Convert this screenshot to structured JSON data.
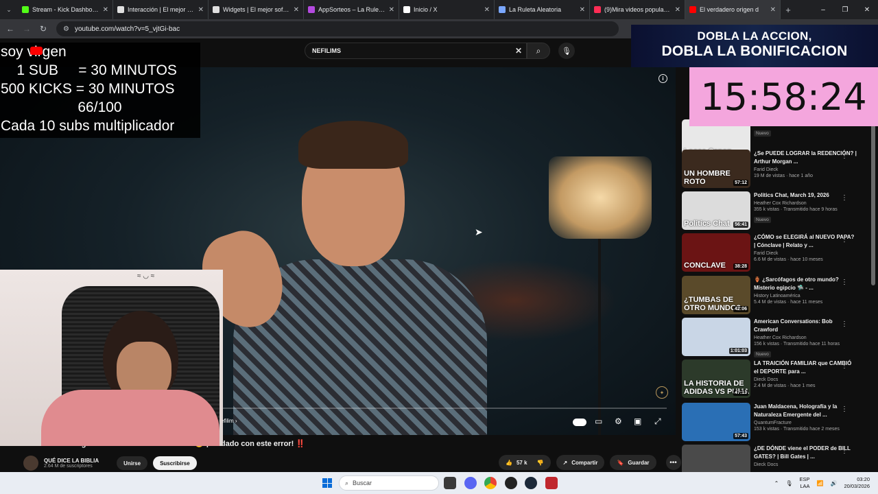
{
  "browser": {
    "menu_icon": "chevron-down-icon",
    "tabs": [
      {
        "title": "Stream - Kick Dashboard",
        "favicon_color": "#53fc18",
        "active": false
      },
      {
        "title": "Interacción | El mejor software",
        "favicon_color": "#e0e0e0",
        "active": false
      },
      {
        "title": "Widgets | El mejor software",
        "favicon_color": "#e0e0e0",
        "active": false
      },
      {
        "title": "AppSorteos – La Ruleta de",
        "favicon_color": "#b44ae0",
        "active": false
      },
      {
        "title": "Inicio / X",
        "favicon_color": "#ffffff",
        "active": false
      },
      {
        "title": "La Ruleta Aleatoria",
        "favicon_color": "#7aa7ff",
        "active": false
      },
      {
        "title": "(9)Mira videos populares",
        "favicon_color": "#ff2d55",
        "active": false
      },
      {
        "title": "El verdadero origen d",
        "favicon_color": "#ff0000",
        "active": true
      }
    ],
    "new_tab": "+",
    "window_controls": [
      "–",
      "❐",
      "✕"
    ],
    "url": "youtube.com/watch?v=5_vjtGi-bac"
  },
  "youtube": {
    "search_value": "NEFILIMS",
    "video_title": "El verdadero origen de los GIGANTES NEFILIM 😳 ¡Cuidado con este error! ‼️",
    "chapter": "efilim ›",
    "channel": {
      "name": "QUÉ DICE LA BIBLIA",
      "subscribers": "2.64 M de suscriptores"
    },
    "join_label": "Unirse",
    "subscribe_label": "Suscribirse",
    "likes": "57 k",
    "share_label": "Compartir",
    "save_label": "Guardar",
    "recommended": [
      {
        "title": "",
        "channel": "",
        "meta": "43 k vistas · hace 4 horas",
        "duration": "54:26",
        "new": "Nuevo",
        "thumb_text": "Loose Canon",
        "thumb_color": "#e8e8e8"
      },
      {
        "title": "¿Se PUEDE LOGRAR la REDENCIÓN? | Arthur Morgan ...",
        "channel": "Farid Dieck",
        "meta": "19 M de vistas · hace 1 año",
        "duration": "57:12",
        "new": "",
        "thumb_text": "UN HOMBRE ROTO",
        "thumb_color": "#3b2a1e"
      },
      {
        "title": "Politics Chat, March 19, 2026",
        "channel": "Heather Cox Richardson",
        "meta": "355 k vistas · Transmitido hace 9 horas",
        "duration": "56:41",
        "new": "Nuevo",
        "thumb_text": "Politics Chat",
        "thumb_color": "#dcdcdc"
      },
      {
        "title": "¿CÓMO se ELEGIRÁ al NUEVO PAPA? | Cónclave | Relato y ...",
        "channel": "Farid Dieck",
        "meta": "6.6 M de vistas · hace 10 meses",
        "duration": "38:28",
        "new": "",
        "thumb_text": "CONCLAVE",
        "thumb_color": "#6b1414"
      },
      {
        "title": "🏺 ¿Sarcófagos de otro mundo? Misterio egipcio 🛸 - ...",
        "channel": "History Latinoamérica",
        "meta": "5.4 M de vistas · hace 11 meses",
        "duration": "42:06",
        "new": "",
        "thumb_text": "¿TUMBAS DE OTRO MUNDO?",
        "thumb_color": "#5a4a2a"
      },
      {
        "title": "American Conversations: Bob Crawford",
        "channel": "Heather Cox Richardson",
        "meta": "156 k vistas · Transmitido hace 11 horas",
        "duration": "1:01:03",
        "new": "Nuevo",
        "thumb_text": "",
        "thumb_color": "#c9d6e6"
      },
      {
        "title": "LA TRAICIÓN FAMILIAR que CAMBIÓ el DEPORTE para ...",
        "channel": "Dieck Docs",
        "meta": "2.4 M de vistas · hace 1 mes",
        "duration": "47:13",
        "new": "",
        "thumb_text": "LA HISTORIA DE ADIDAS VS PUMA",
        "thumb_color": "#2c3a2a"
      },
      {
        "title": "Juan Maldacena, Holografía y la Naturaleza Emergente del ...",
        "channel": "QuantumFracture",
        "meta": "153 k vistas · Transmitido hace 2 meses",
        "duration": "57:43",
        "new": "",
        "thumb_text": "",
        "thumb_color": "#2a6fb5"
      },
      {
        "title": "¿DE DÓNDE viene el PODER de BILL GATES? | Bill Gates | ...",
        "channel": "Dieck Docs",
        "meta": "",
        "duration": "",
        "new": "",
        "thumb_text": "",
        "thumb_color": "#4a4a4a"
      }
    ]
  },
  "stream_overlay": {
    "lines": [
      "soy virgen",
      "    1 SUB     = 30 MINUTOS",
      "500 KICKS = 30 MINUTOS",
      "66/100",
      "Cada 10 subs multiplicador"
    ],
    "bonus_line1": "DOBLA LA ACCION,",
    "bonus_line2": "DOBLA LA BONIFICACION",
    "timer": "15:58:24"
  },
  "taskbar": {
    "search_placeholder": "Buscar",
    "lang_top": "ESP",
    "lang_bottom": "LAA",
    "time": "03:20",
    "date": "20/03/2026"
  },
  "colors": {
    "youtube_red": "#ff0000",
    "timer_bg": "#f4a6dd",
    "bonus_bg": "#0b1030"
  }
}
